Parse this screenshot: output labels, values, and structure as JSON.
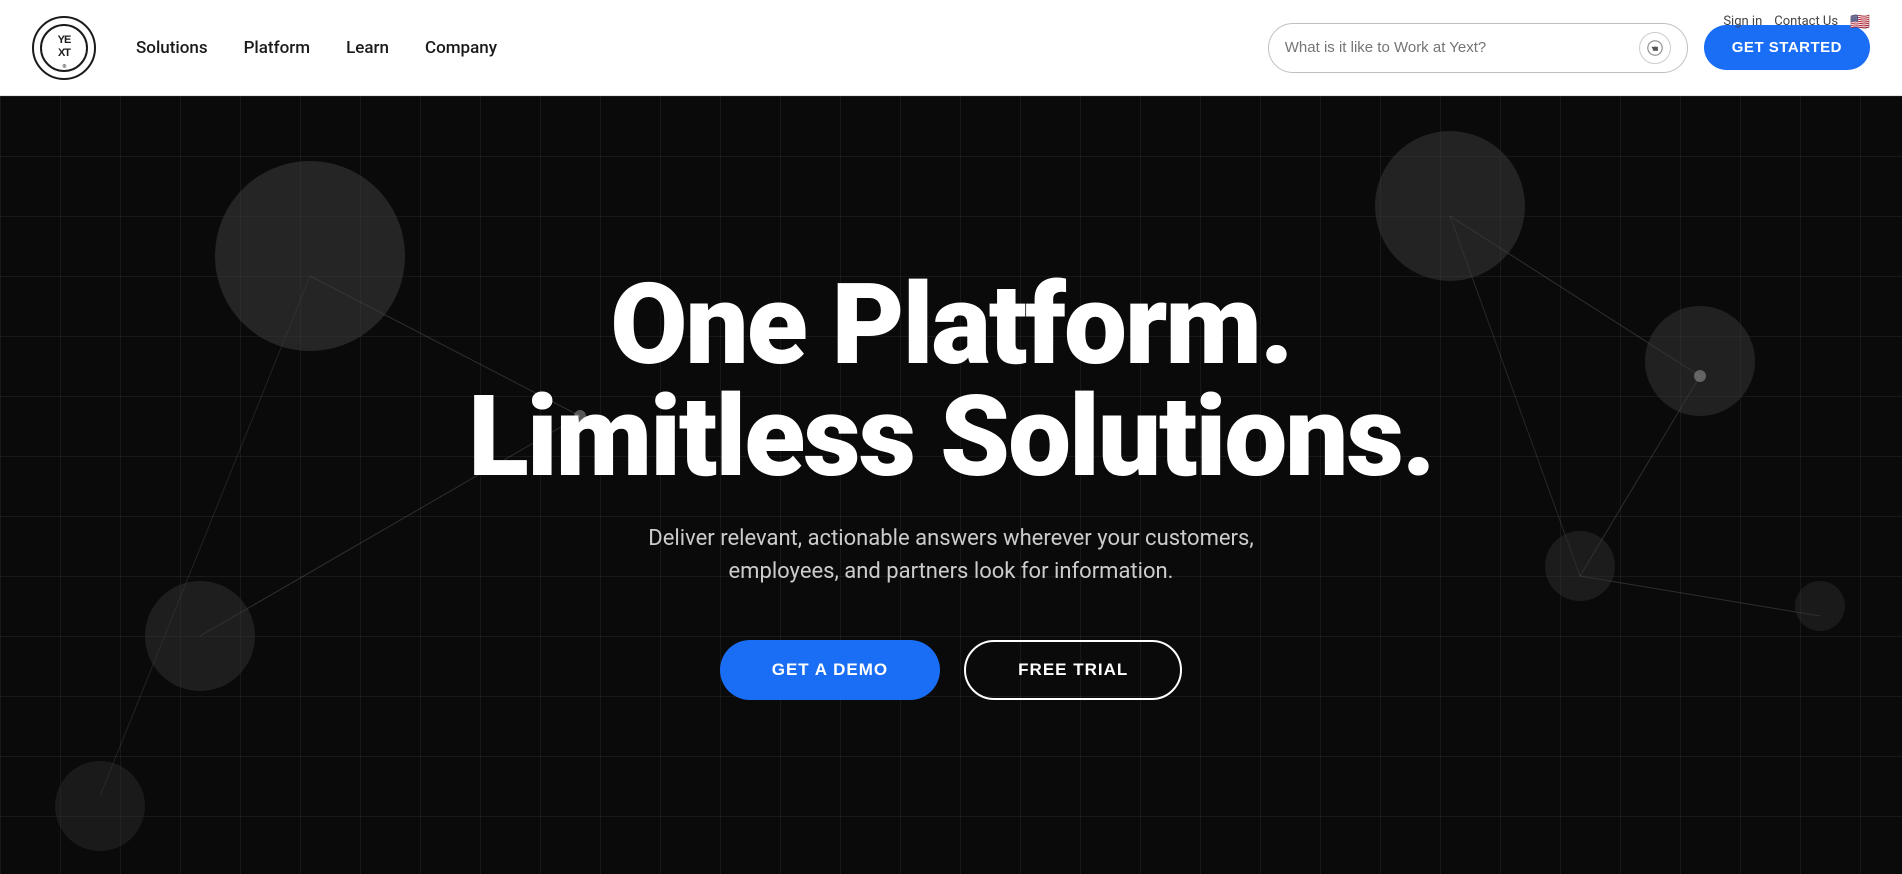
{
  "topbar": {
    "sign_in": "Sign in",
    "contact_us": "Contact Us"
  },
  "navbar": {
    "logo_text": "YE\nXT",
    "logo_symbol": "Yext",
    "nav_items": [
      {
        "label": "Solutions"
      },
      {
        "label": "Platform"
      },
      {
        "label": "Learn"
      },
      {
        "label": "Company"
      }
    ],
    "search_placeholder": "What is it like to Work at Yext?",
    "get_started_label": "GET STARTED"
  },
  "hero": {
    "headline_line1": "One Platform.",
    "headline_line2": "Limitless Solutions.",
    "subtext": "Deliver relevant, actionable answers wherever your customers, employees, and partners look for information.",
    "btn_demo": "GET A DEMO",
    "btn_trial": "FREE TRIAL"
  }
}
